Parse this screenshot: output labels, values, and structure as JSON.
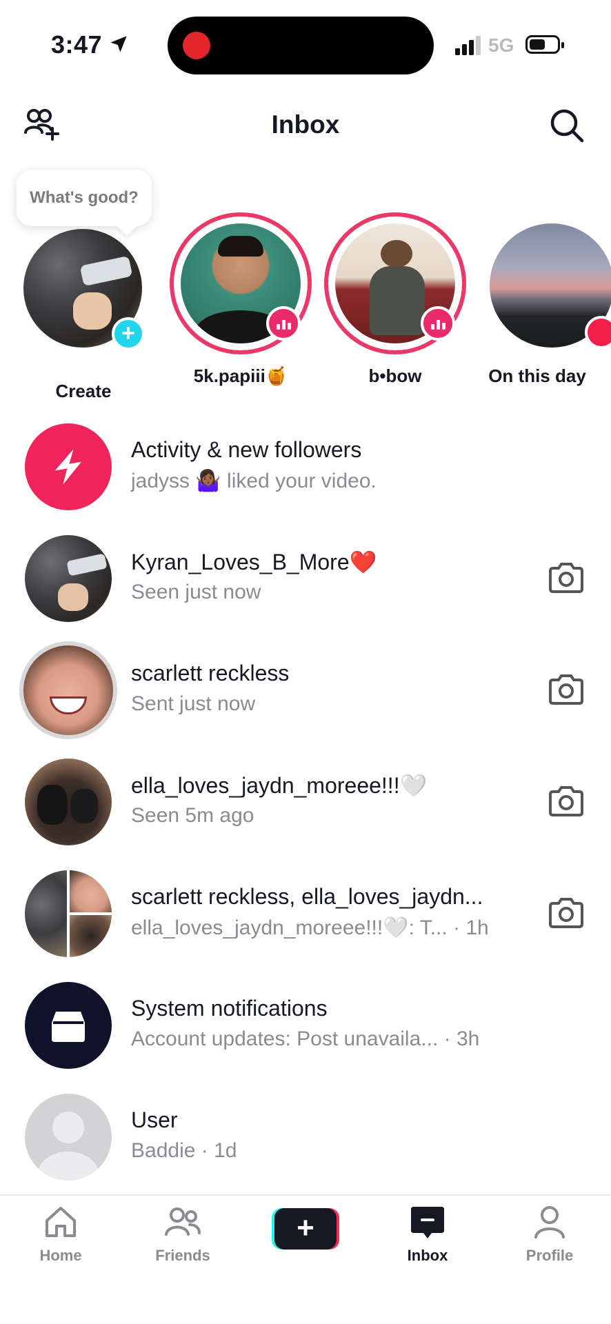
{
  "status_bar": {
    "time": "3:47",
    "network": "5G"
  },
  "header": {
    "title": "Inbox"
  },
  "tooltip": {
    "text": "What's good?"
  },
  "stories": [
    {
      "label": "Create"
    },
    {
      "label": "5k.papiii🍯"
    },
    {
      "label": "b•bow"
    },
    {
      "label": "On this day"
    }
  ],
  "inbox_rows": [
    {
      "title": "Activity & new followers",
      "subtitle": "jadyss 🤷🏾‍♀️ liked your video."
    },
    {
      "title": "Kyran_Loves_B_More❤️",
      "subtitle": "Seen just now"
    },
    {
      "title": "scarlett reckless",
      "subtitle": "Sent just now"
    },
    {
      "title": "ella_loves_jaydn_moreee!!!🤍",
      "subtitle": "Seen 5m ago"
    },
    {
      "title": "scarlett reckless, ella_loves_jaydn...",
      "subtitle": "ella_loves_jaydn_moreee!!!🤍: T...  · 1h"
    },
    {
      "title": "System notifications",
      "subtitle": "Account updates: Post unavaila...  · 3h"
    },
    {
      "title": "User",
      "subtitle": "Baddie · 1d"
    }
  ],
  "bottom_nav": {
    "home": "Home",
    "friends": "Friends",
    "create": "+",
    "inbox": "Inbox",
    "profile": "Profile"
  },
  "colors": {
    "accent_pink": "#ea3869",
    "accent_cyan": "#20d5ec",
    "text_primary": "#161823",
    "text_secondary": "#8a8b91"
  }
}
